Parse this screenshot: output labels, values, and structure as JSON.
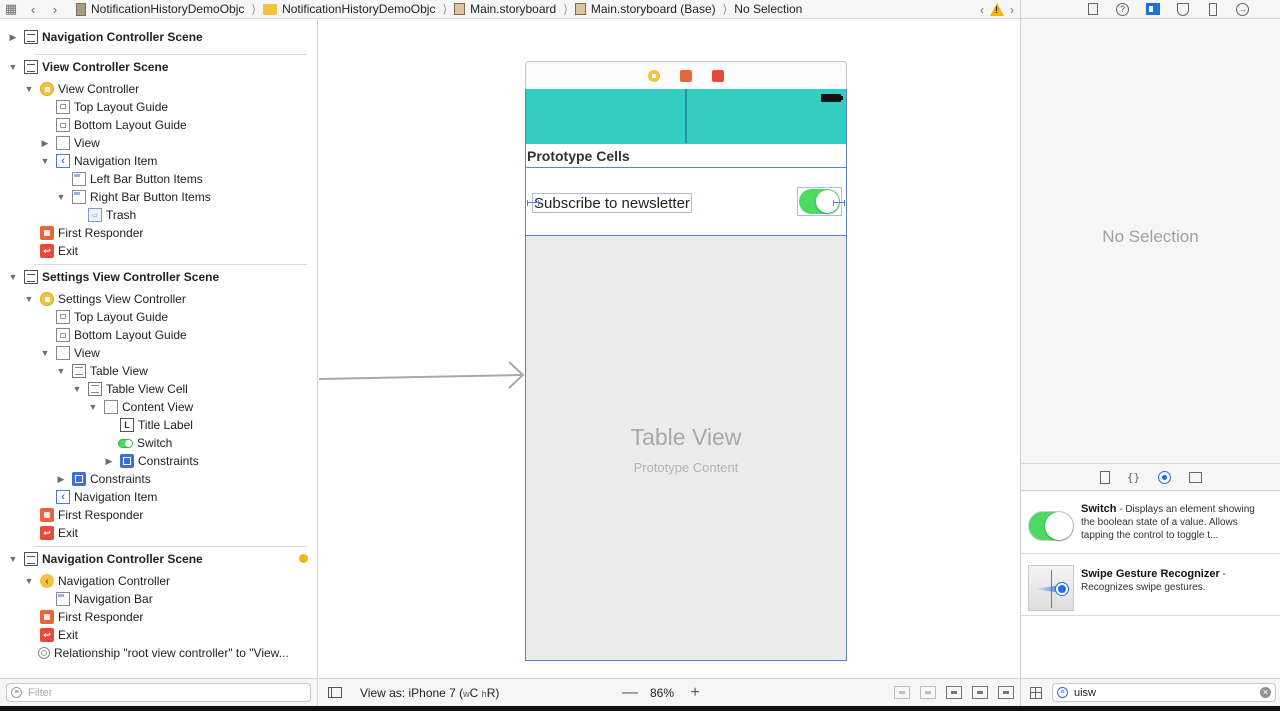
{
  "jumpbar": {
    "breadcrumbs": [
      {
        "label": "NotificationHistoryDemoObjc",
        "icon": "project-icon"
      },
      {
        "label": "NotificationHistoryDemoObjc",
        "icon": "folder-icon"
      },
      {
        "label": "Main.storyboard",
        "icon": "storyboard-file-icon"
      },
      {
        "label": "Main.storyboard (Base)",
        "icon": "storyboard-file-icon"
      },
      {
        "label": "No Selection",
        "icon": ""
      }
    ]
  },
  "outline": {
    "rows": [
      {
        "label": "Navigation Controller Scene",
        "bold": true
      },
      {
        "label": "View Controller Scene",
        "bold": true
      },
      {
        "label": "View Controller"
      },
      {
        "label": "Top Layout Guide"
      },
      {
        "label": "Bottom Layout Guide"
      },
      {
        "label": "View"
      },
      {
        "label": "Navigation Item"
      },
      {
        "label": "Left Bar Button Items"
      },
      {
        "label": "Right Bar Button Items"
      },
      {
        "label": "Trash"
      },
      {
        "label": "First Responder"
      },
      {
        "label": "Exit"
      },
      {
        "label": "Settings View Controller Scene",
        "bold": true
      },
      {
        "label": "Settings View Controller"
      },
      {
        "label": "Top Layout Guide"
      },
      {
        "label": "Bottom Layout Guide"
      },
      {
        "label": "View"
      },
      {
        "label": "Table View"
      },
      {
        "label": "Table View Cell"
      },
      {
        "label": "Content View"
      },
      {
        "label": "Title Label"
      },
      {
        "label": "Switch"
      },
      {
        "label": "Constraints"
      },
      {
        "label": "Constraints"
      },
      {
        "label": "Navigation Item"
      },
      {
        "label": "First Responder"
      },
      {
        "label": "Exit"
      },
      {
        "label": "Navigation Controller Scene",
        "bold": true
      },
      {
        "label": "Navigation Controller"
      },
      {
        "label": "Navigation Bar"
      },
      {
        "label": "First Responder"
      },
      {
        "label": "Exit"
      },
      {
        "label": "Relationship \"root view controller\" to \"View..."
      }
    ],
    "filter_placeholder": "Filter"
  },
  "canvas": {
    "prototype_cells_header": "Prototype Cells",
    "cell_label": "Subscribe to newsletter",
    "switch_on": true,
    "table_view_title": "Table View",
    "table_view_subtitle": "Prototype Content",
    "navbar_color": "#33cec1",
    "switch_color": "#4cd964",
    "selection_color": "#5a7fd3"
  },
  "canvas_bar": {
    "view_as": "View as: iPhone 7 (",
    "size_class_w": "w",
    "size_class_c": "C ",
    "size_class_h": "h",
    "size_class_r": "R)",
    "zoom_out": "—",
    "zoom_level": "86%",
    "zoom_in": "+"
  },
  "inspector": {
    "no_selection": "No Selection",
    "library": [
      {
        "title": "Switch",
        "desc": " - Displays an element showing the boolean state of a value. Allows tapping the control to toggle t...",
        "icon": "switch-icon"
      },
      {
        "title": "Swipe Gesture Recognizer",
        "desc": " - Recognizes swipe gestures.",
        "icon": "swipe-gesture-icon"
      }
    ],
    "search_value": "uisw"
  }
}
